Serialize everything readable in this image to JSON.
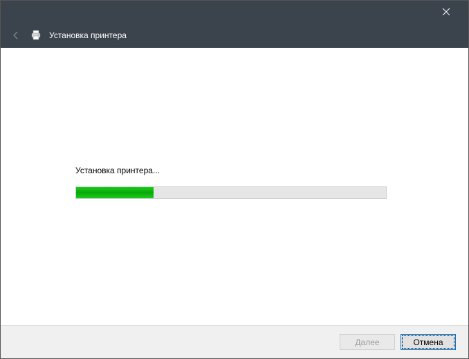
{
  "header": {
    "title": "Установка принтера"
  },
  "content": {
    "status_text": "Установка принтера...",
    "progress_percent": 25
  },
  "footer": {
    "next_label": "Далее",
    "cancel_label": "Отмена"
  }
}
